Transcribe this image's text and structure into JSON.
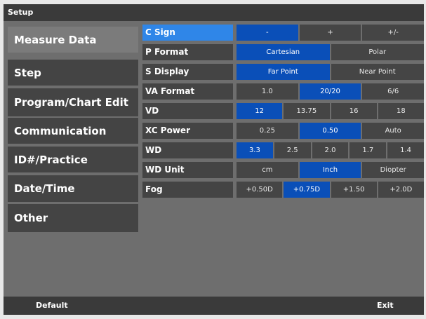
{
  "window": {
    "title": "Setup"
  },
  "sidebar": {
    "items": [
      {
        "label": "Measure Data"
      },
      {
        "label": "Step"
      },
      {
        "label": "Program/Chart Edit"
      },
      {
        "label": "Communication"
      },
      {
        "label": "ID#/Practice"
      },
      {
        "label": "Date/Time"
      },
      {
        "label": "Other"
      }
    ],
    "active_index": 0
  },
  "settings": [
    {
      "label": "C Sign",
      "options": [
        "-",
        "+",
        "+/-"
      ],
      "selected": 0
    },
    {
      "label": "P Format",
      "options": [
        "Cartesian",
        "Polar"
      ],
      "selected": 0
    },
    {
      "label": "S Display",
      "options": [
        "Far Point",
        "Near Point"
      ],
      "selected": 0
    },
    {
      "label": "VA Format",
      "options": [
        "1.0",
        "20/20",
        "6/6"
      ],
      "selected": 1
    },
    {
      "label": "VD",
      "options": [
        "12",
        "13.75",
        "16",
        "18"
      ],
      "selected": 0
    },
    {
      "label": "XC Power",
      "options": [
        "0.25",
        "0.50",
        "Auto"
      ],
      "selected": 1
    },
    {
      "label": "WD",
      "options": [
        "3.3",
        "2.5",
        "2.0",
        "1.7",
        "1.4"
      ],
      "selected": 0
    },
    {
      "label": "WD Unit",
      "options": [
        "cm",
        "Inch",
        "Diopter"
      ],
      "selected": 1
    },
    {
      "label": "Fog",
      "options": [
        "+0.50D",
        "+0.75D",
        "+1.50",
        "+2.0D"
      ],
      "selected": 1
    }
  ],
  "footer": {
    "default_label": "Default",
    "exit_label": "Exit"
  },
  "colors": {
    "selected_option": "#0a4fb8",
    "active_row_label": "#2f86e8",
    "panel": "#444444",
    "background": "#6e6e6e"
  }
}
